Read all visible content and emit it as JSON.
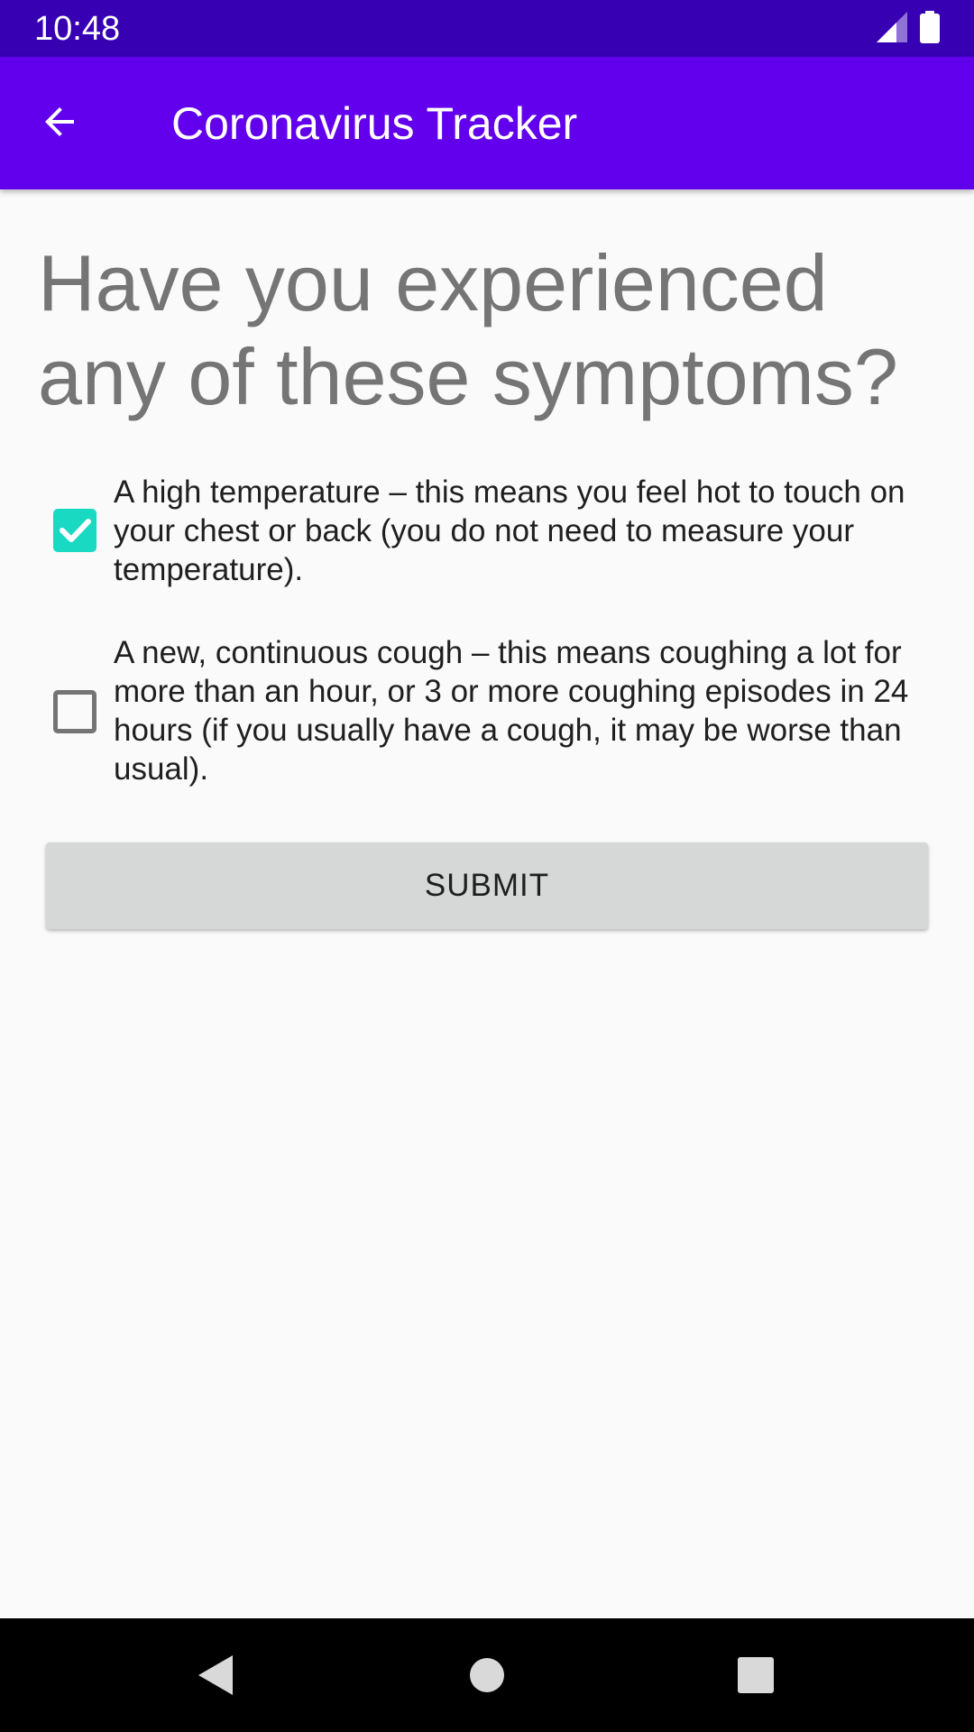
{
  "status_bar": {
    "time": "10:48",
    "icons": [
      "signal-icon",
      "battery-icon"
    ]
  },
  "app_bar": {
    "back_icon": "arrow-back-icon",
    "title": "Coronavirus Tracker",
    "background": "#6200ee"
  },
  "main": {
    "question": "Have you experienced any of these symptoms?",
    "options": [
      {
        "label": "A high temperature – this means you feel hot to touch on your chest or back (you do not need to measure your temperature).",
        "checked": true
      },
      {
        "label": "A new, continuous cough – this means coughing a lot for more than an hour, or 3 or more coughing episodes in 24 hours (if you usually have a cough, it may be worse than usual).",
        "checked": false
      }
    ],
    "submit_label": "SUBMIT"
  },
  "nav_bar": {
    "icons": [
      "nav-back-icon",
      "nav-home-icon",
      "nav-recents-icon"
    ]
  },
  "colors": {
    "status_bar": "#3700b3",
    "app_bar": "#6200ee",
    "accent": "#1ad9c3",
    "question_text": "#757575"
  }
}
